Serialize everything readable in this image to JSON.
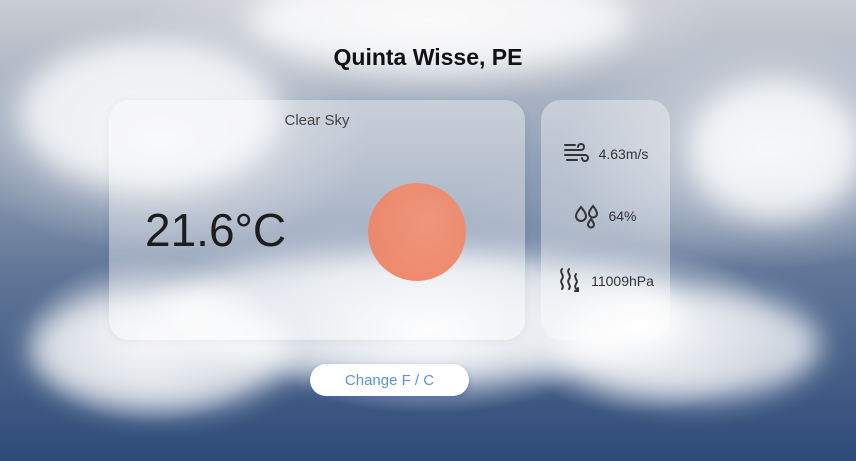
{
  "location": "Quinta Wisse, PE",
  "weather": {
    "description": "Clear Sky",
    "temperature": "21.6°C",
    "icon": "sun-icon",
    "icon_color": "#ee8466"
  },
  "details": {
    "wind": {
      "icon": "wind-icon",
      "value": "4.63m/s"
    },
    "humidity": {
      "icon": "humidity-icon",
      "value": "64%"
    },
    "pressure": {
      "icon": "heat-waves-icon",
      "value": "11009hPa"
    }
  },
  "toggle_button": {
    "label": "Change F / C",
    "text_color": "#5a93d8"
  }
}
